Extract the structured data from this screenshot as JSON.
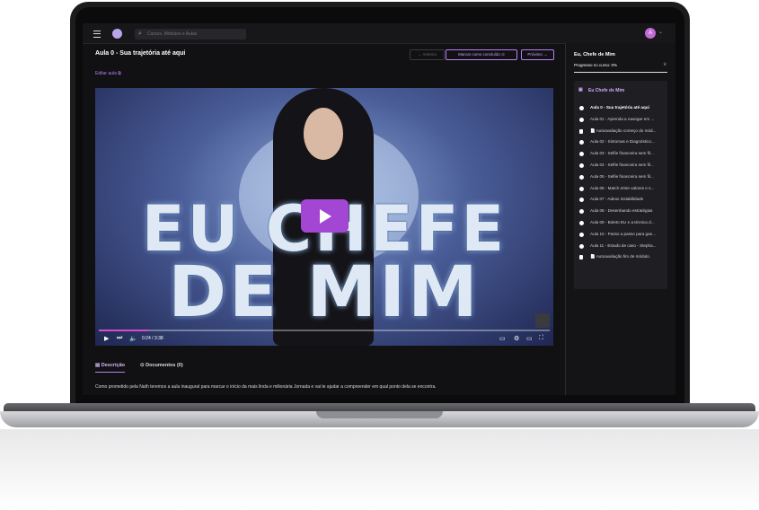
{
  "header": {
    "search_placeholder": "Cursos, Módulos e Aulas",
    "avatar_initial": "A"
  },
  "lesson": {
    "title": "Aula 0 - Sua trajetória até aqui",
    "prev_label": "← Anterior",
    "complete_label": "Marcar como concluído ⊙",
    "next_label": "Próximo →",
    "edit_label": "Editar aula ⧉"
  },
  "video": {
    "overlay_line1": "EU CHEFE",
    "overlay_line2": "DE MIM",
    "time": "0:24 / 3:38",
    "progress_fraction": 0.11
  },
  "tabs": {
    "description": "Descrição",
    "documents": "Documentos (0)"
  },
  "description_text": "Como prometido pela Nath teremos a aula inaugural para marcar o início da mais linda e milionária Jornada e vai te ajudar a compreender em qual ponto dela se encontra.",
  "sidebar": {
    "course_title": "Eu, Chefe de Mim",
    "progress_label": "Progresso no curso: 0%",
    "progress_fraction": 0.0,
    "module_title": "Eu Chefe de Mim",
    "lessons": [
      {
        "label": "Aula 0 - Sua trajetória até aqui",
        "type": "video",
        "active": true
      },
      {
        "label": "Aula 01 - Aprenda a navegar em ...",
        "type": "video"
      },
      {
        "label": "📄 Autoavaliação começo do mód...",
        "type": "doc"
      },
      {
        "label": "Aula 02 - Sintomas e Diagnóstico...",
        "type": "video"
      },
      {
        "label": "Aula 03 - Selfie financeira sem fil...",
        "type": "video"
      },
      {
        "label": "Aula 04 - Selfie financeira sem fil...",
        "type": "video"
      },
      {
        "label": "Aula 05 - Selfie financeira sem fil...",
        "type": "video"
      },
      {
        "label": "Aula 06 - Match entre valores e s...",
        "type": "video"
      },
      {
        "label": "Aula 07 - Adeus instabilidade",
        "type": "video"
      },
      {
        "label": "Aula 08 - Desenhando estratégias",
        "type": "video"
      },
      {
        "label": "Aula 09 - Boleto EU e a técnica d...",
        "type": "video"
      },
      {
        "label": "Aula 10 - Passo a passo para gan...",
        "type": "video"
      },
      {
        "label": "Aula 11 - Estudo de caso - Stepha...",
        "type": "video"
      },
      {
        "label": "📄 Autoavaliação fim de módulo.",
        "type": "doc"
      }
    ]
  }
}
